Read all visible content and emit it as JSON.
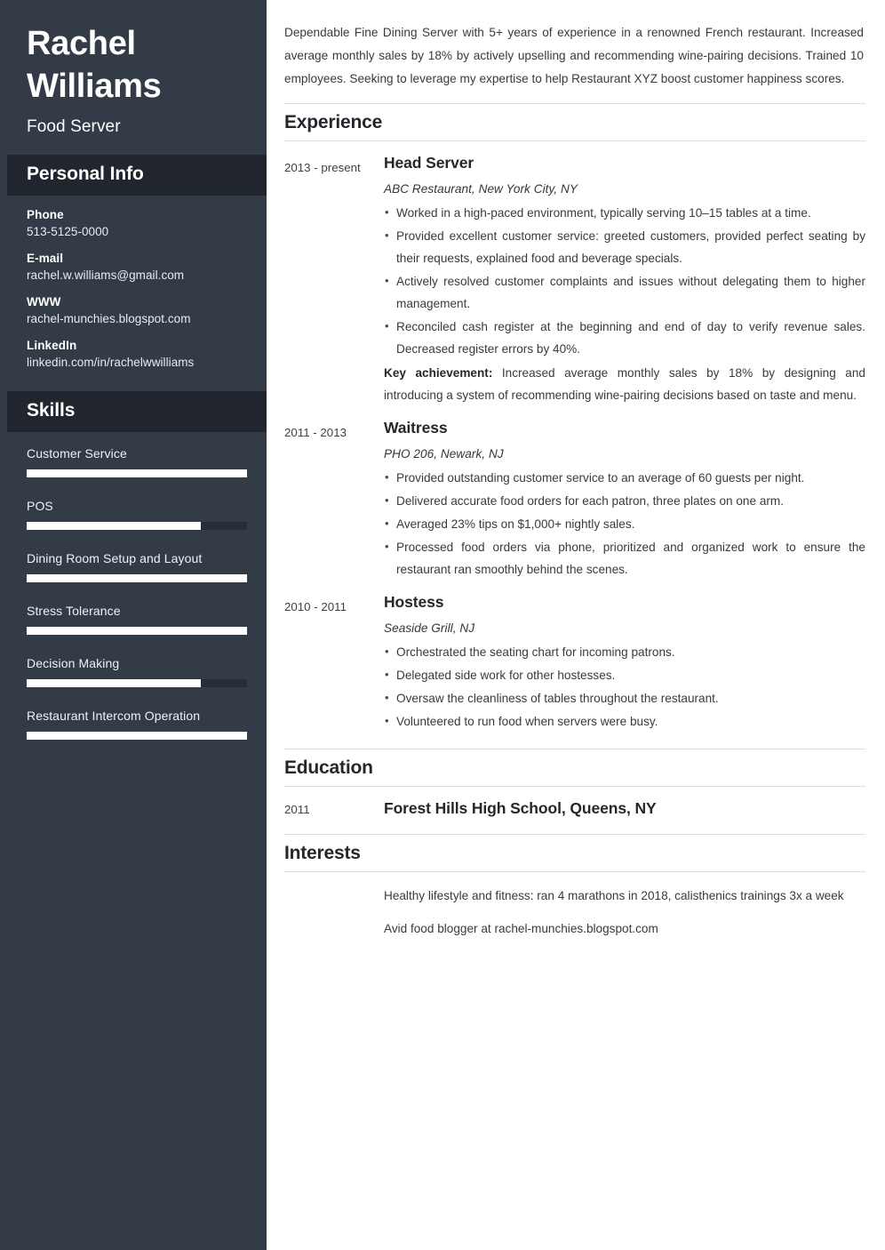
{
  "colors": {
    "sidebar_bg": "#333b47",
    "sidebar_heading_bg": "#21252e",
    "skill_fill": "#ffffff",
    "skill_track": "#282d38",
    "text_dark": "#24272c",
    "rule": "#dedede"
  },
  "sidebar": {
    "first_name": "Rachel",
    "last_name": "Williams",
    "job_title": "Food Server",
    "personal_info": {
      "heading": "Personal Info",
      "items": [
        {
          "label": "Phone",
          "value": "513-5125-0000"
        },
        {
          "label": "E-mail",
          "value": "rachel.w.williams@gmail.com"
        },
        {
          "label": "WWW",
          "value": "rachel-munchies.blogspot.com"
        },
        {
          "label": "LinkedIn",
          "value": "linkedin.com/in/rachelwwilliams"
        }
      ]
    },
    "skills": {
      "heading": "Skills",
      "items": [
        {
          "name": "Customer Service",
          "level": 100
        },
        {
          "name": "POS",
          "level": 79
        },
        {
          "name": "Dining Room Setup and Layout",
          "level": 100
        },
        {
          "name": "Stress Tolerance",
          "level": 100
        },
        {
          "name": "Decision Making",
          "level": 79
        },
        {
          "name": "Restaurant Intercom Operation",
          "level": 100
        }
      ]
    }
  },
  "main": {
    "summary": "Dependable Fine Dining Server with 5+ years of experience in a renowned French restaurant. Increased average monthly sales by 18% by actively upselling and recommending wine-pairing decisions. Trained 10 employees. Seeking to leverage my expertise to help Restaurant XYZ boost customer happiness scores.",
    "experience": {
      "heading": "Experience",
      "entries": [
        {
          "date": "2013 - present",
          "role": "Head Server",
          "company": "ABC Restaurant, New York City, NY",
          "bullets": [
            "Worked in a high-paced environment, typically serving 10–15 tables at a time.",
            "Provided excellent customer service: greeted customers, provided perfect seating by their requests, explained food and beverage specials.",
            "Actively resolved customer complaints and issues without delegating them to higher management.",
            "Reconciled cash register at the beginning and end of day to verify revenue sales. Decreased register errors by 40%."
          ],
          "key_achievement_label": "Key achievement:",
          "key_achievement_text": " Increased average monthly sales by 18% by designing and introducing a system of recommending wine-pairing decisions based on taste and menu."
        },
        {
          "date": "2011 - 2013",
          "role": "Waitress",
          "company": "PHO 206, Newark, NJ",
          "bullets": [
            "Provided outstanding customer service to an average of 60 guests per night.",
            "Delivered accurate food orders for each patron, three plates on one arm.",
            "Averaged 23% tips on $1,000+ nightly sales.",
            "Processed food orders via phone, prioritized and organized work to ensure the restaurant ran smoothly behind the scenes."
          ]
        },
        {
          "date": "2010 - 2011",
          "role": "Hostess",
          "company": "Seaside Grill, NJ",
          "bullets": [
            "Orchestrated the seating chart for incoming patrons.",
            "Delegated side work for other hostesses.",
            "Oversaw the cleanliness of tables throughout the restaurant.",
            "Volunteered to run food when servers were busy."
          ]
        }
      ]
    },
    "education": {
      "heading": "Education",
      "entries": [
        {
          "date": "2011",
          "school": "Forest Hills High School, Queens, NY"
        }
      ]
    },
    "interests": {
      "heading": "Interests",
      "items": [
        "Healthy lifestyle and fitness: ran 4 marathons in 2018, calisthenics trainings 3x a week",
        "Avid food blogger at rachel-munchies.blogspot.com"
      ]
    }
  }
}
